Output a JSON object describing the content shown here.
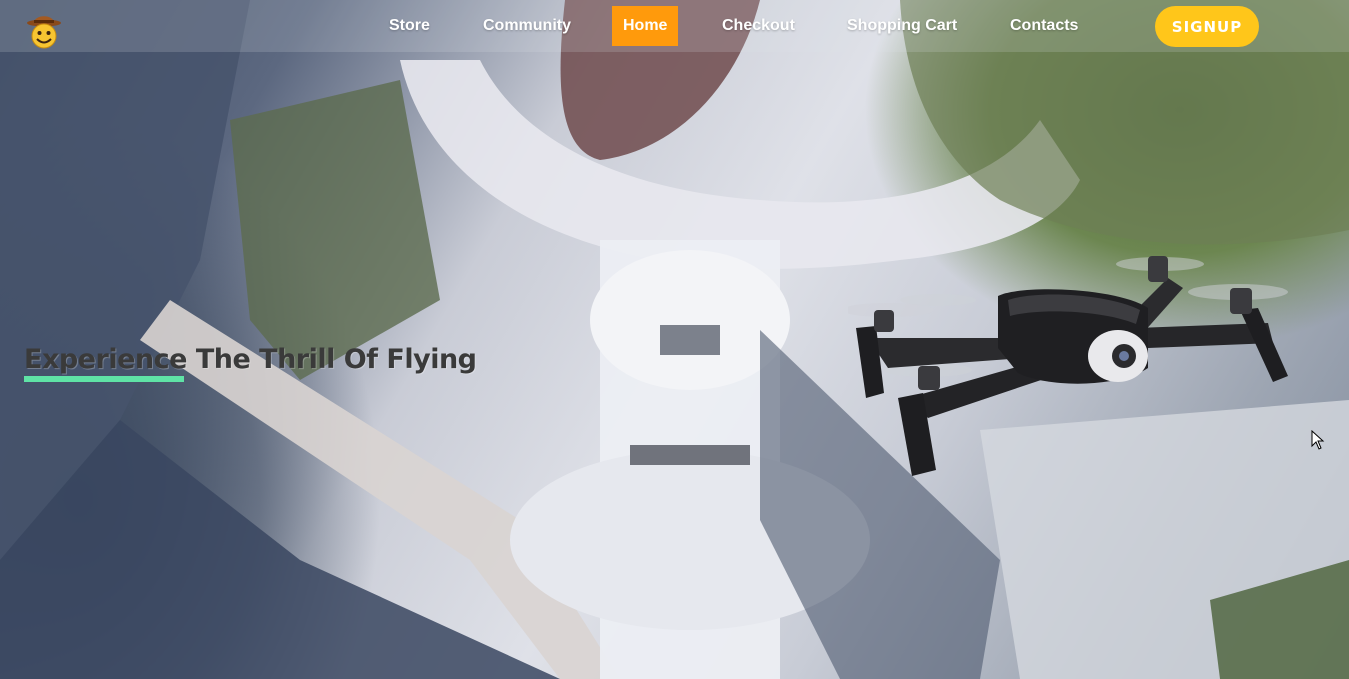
{
  "nav": {
    "logo_icon": "cowboy-smiley-icon",
    "items": [
      {
        "label": "Store"
      },
      {
        "label": "Community"
      },
      {
        "label": "Home",
        "active": true
      },
      {
        "label": "Checkout"
      },
      {
        "label": "Shopping Cart"
      },
      {
        "label": "Contacts"
      }
    ],
    "signup_label": "SIGNUP"
  },
  "hero": {
    "headline": "Experience The Thrill Of Flying",
    "image": "drone-icon",
    "background": "aerial-building-photo"
  },
  "colors": {
    "active_nav": "#ff9a0c",
    "signup": "#ffc61a",
    "underline": "#5fe3a6",
    "headline": "#3a3a3a"
  }
}
